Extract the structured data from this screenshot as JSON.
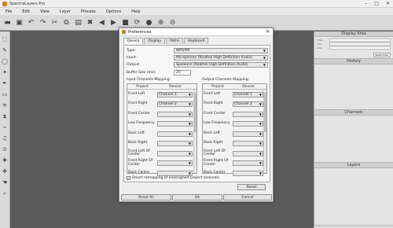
{
  "window": {
    "title": "SpectraLayers Pro"
  },
  "menu": [
    "File",
    "Edit",
    "View",
    "Layer",
    "Process",
    "Options",
    "Help"
  ],
  "right_panels": {
    "display_area": "Display Area",
    "history": "History",
    "channels": "Channels",
    "layers": "Layers",
    "reset_view": "Reset View"
  },
  "dialog": {
    "title": "Preferences",
    "tabs": [
      "Device",
      "Display",
      "Paths",
      "Keyboard"
    ],
    "active_tab": "Device",
    "fields": {
      "type_label": "Type:",
      "type_value": "WASAPI",
      "input_label": "Input:",
      "input_value": "Microphone (Realtek High Definition Audio)",
      "output_label": "Output:",
      "output_value": "Speakers (Realtek High Definition Audio)",
      "buffer_label": "Buffer Size (ms):",
      "buffer_value": "20"
    },
    "input_mapping": {
      "title": "Input Channels Mapping:",
      "headers": [
        "Project",
        "Device"
      ],
      "rows": [
        {
          "project": "Front Left",
          "device": "Channel 1"
        },
        {
          "project": "Front Right",
          "device": "Channel 2"
        },
        {
          "project": "Front Center",
          "device": ""
        },
        {
          "project": "Low Frequency",
          "device": ""
        },
        {
          "project": "Back Left",
          "device": ""
        },
        {
          "project": "Back Right",
          "device": ""
        },
        {
          "project": "Front Left Of Center",
          "device": ""
        },
        {
          "project": "Front Right Of Center",
          "device": ""
        },
        {
          "project": "Back Center",
          "device": ""
        }
      ]
    },
    "output_mapping": {
      "title": "Output Channels Mapping:",
      "headers": [
        "Project",
        "Device"
      ],
      "rows": [
        {
          "project": "Front Left",
          "device": "Channel 1"
        },
        {
          "project": "Front Right",
          "device": "Channel 2"
        },
        {
          "project": "Front Center",
          "device": ""
        },
        {
          "project": "Low Frequency",
          "device": ""
        },
        {
          "project": "Back Left",
          "device": ""
        },
        {
          "project": "Back Right",
          "device": ""
        },
        {
          "project": "Front Left Of Center",
          "device": ""
        },
        {
          "project": "Front Right Of Center",
          "device": ""
        },
        {
          "project": "Back Center",
          "device": ""
        }
      ]
    },
    "smart_remap_label": "Smart remapping of unassigned project channels",
    "smart_remap_checked": true,
    "buttons": {
      "reset": "Reset",
      "reset_all": "Reset All",
      "ok": "Ok",
      "cancel": "Cancel"
    }
  }
}
